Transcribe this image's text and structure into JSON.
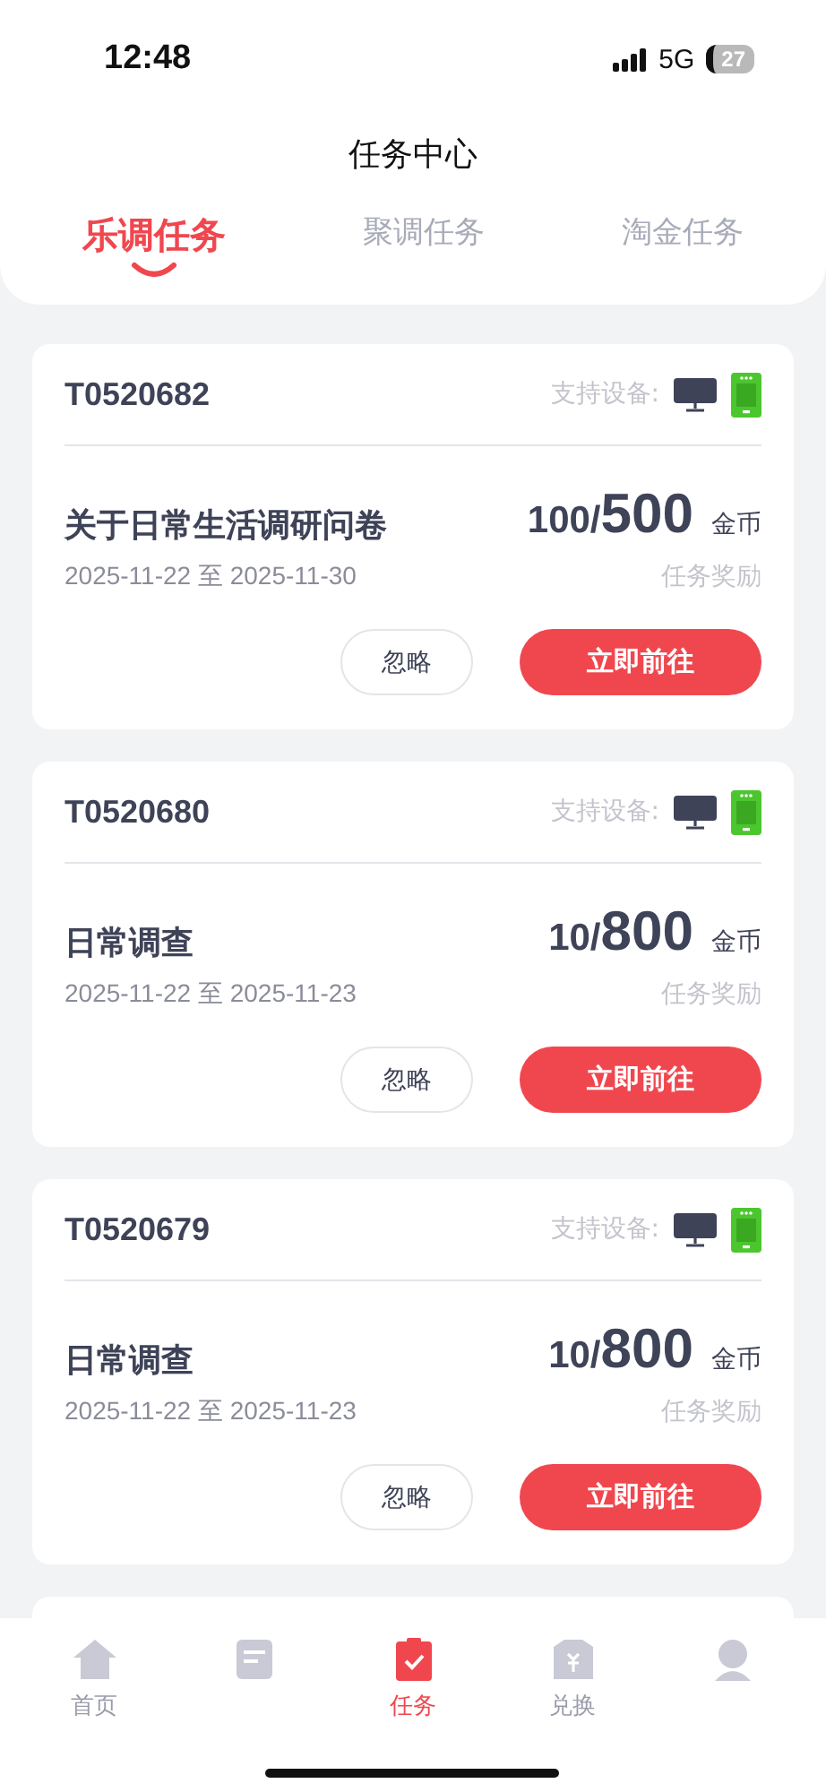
{
  "status_bar": {
    "time": "12:48",
    "network": "5G",
    "battery": "27"
  },
  "header": {
    "title": "任务中心"
  },
  "tabs": [
    {
      "label": "乐调任务",
      "selected": true
    },
    {
      "label": "聚调任务",
      "selected": false
    },
    {
      "label": "淘金任务",
      "selected": false
    }
  ],
  "tasks": [
    {
      "id": "T0520682",
      "device_label": "支持设备:",
      "title": "关于日常生活调研问卷",
      "dates": "2025-11-22 至 2025-11-30",
      "reward_current": "100/",
      "reward_total": "500",
      "unit": "金币",
      "reward_label": "任务奖励",
      "ignore_button": "忽略",
      "go_button": "立即前往"
    },
    {
      "id": "T0520680",
      "device_label": "支持设备:",
      "title": "日常调查",
      "dates": "2025-11-22 至 2025-11-23",
      "reward_current": "10/",
      "reward_total": "800",
      "unit": "金币",
      "reward_label": "任务奖励",
      "ignore_button": "忽略",
      "go_button": "立即前往"
    },
    {
      "id": "T0520679",
      "device_label": "支持设备:",
      "title": "日常调查",
      "dates": "2025-11-22 至 2025-11-23",
      "reward_current": "10/",
      "reward_total": "800",
      "unit": "金币",
      "reward_label": "任务奖励",
      "ignore_button": "忽略",
      "go_button": "立即前往"
    }
  ],
  "bottom_nav": [
    {
      "kind": "home",
      "label": "首页",
      "selected": false
    },
    {
      "kind": "survey",
      "selected": false
    },
    {
      "kind": "task",
      "label": "任务",
      "selected": true
    },
    {
      "kind": "exchange",
      "label": "兑换",
      "selected": false
    },
    {
      "kind": "profile",
      "selected": false
    }
  ]
}
